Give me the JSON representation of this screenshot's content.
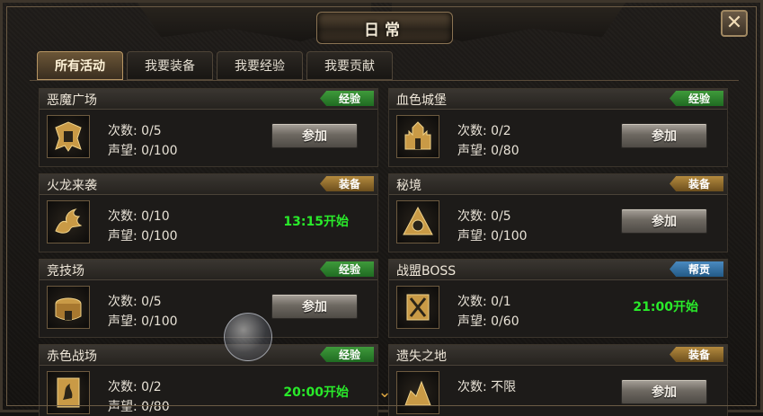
{
  "window": {
    "title": "日常",
    "close_label": "✕"
  },
  "tabs": [
    {
      "label": "所有活动",
      "active": true
    },
    {
      "label": "我要装备",
      "active": false
    },
    {
      "label": "我要经验",
      "active": false
    },
    {
      "label": "我要贡献",
      "active": false
    }
  ],
  "activities": [
    {
      "name": "恶魔广场",
      "tag": "经验",
      "tag_type": "exp",
      "count": "次数: 0/5",
      "reputation": "声望: 0/100",
      "action": "参加",
      "icon": "demon-square-icon"
    },
    {
      "name": "血色城堡",
      "tag": "经验",
      "tag_type": "exp",
      "count": "次数: 0/2",
      "reputation": "声望: 0/80",
      "action": "参加",
      "icon": "castle-icon"
    },
    {
      "name": "火龙来袭",
      "tag": "装备",
      "tag_type": "equip",
      "count": "次数: 0/10",
      "reputation": "声望: 0/100",
      "time": "13:15开始",
      "icon": "dragon-icon"
    },
    {
      "name": "秘境",
      "tag": "装备",
      "tag_type": "equip",
      "count": "次数: 0/5",
      "reputation": "声望: 0/100",
      "action": "参加",
      "icon": "secret-realm-icon"
    },
    {
      "name": "竞技场",
      "tag": "经验",
      "tag_type": "exp",
      "count": "次数: 0/5",
      "reputation": "声望: 0/100",
      "action": "参加",
      "icon": "arena-icon"
    },
    {
      "name": "战盟BOSS",
      "tag": "帮贡",
      "tag_type": "help",
      "count": "次数: 0/1",
      "reputation": "声望: 0/60",
      "time": "21:00开始",
      "icon": "guild-boss-icon"
    },
    {
      "name": "赤色战场",
      "tag": "经验",
      "tag_type": "exp",
      "count": "次数: 0/2",
      "reputation": "声望: 0/80",
      "time": "20:00开始",
      "icon": "red-battlefield-icon"
    },
    {
      "name": "遗失之地",
      "tag": "装备",
      "tag_type": "equip",
      "count": "次数: 不限",
      "reputation": "",
      "action": "参加",
      "icon": "lost-land-icon"
    }
  ],
  "colors": {
    "exp": "#2f8a30",
    "equip": "#a07a33",
    "help": "#3a7ab0",
    "time_text": "#29ea2a"
  }
}
